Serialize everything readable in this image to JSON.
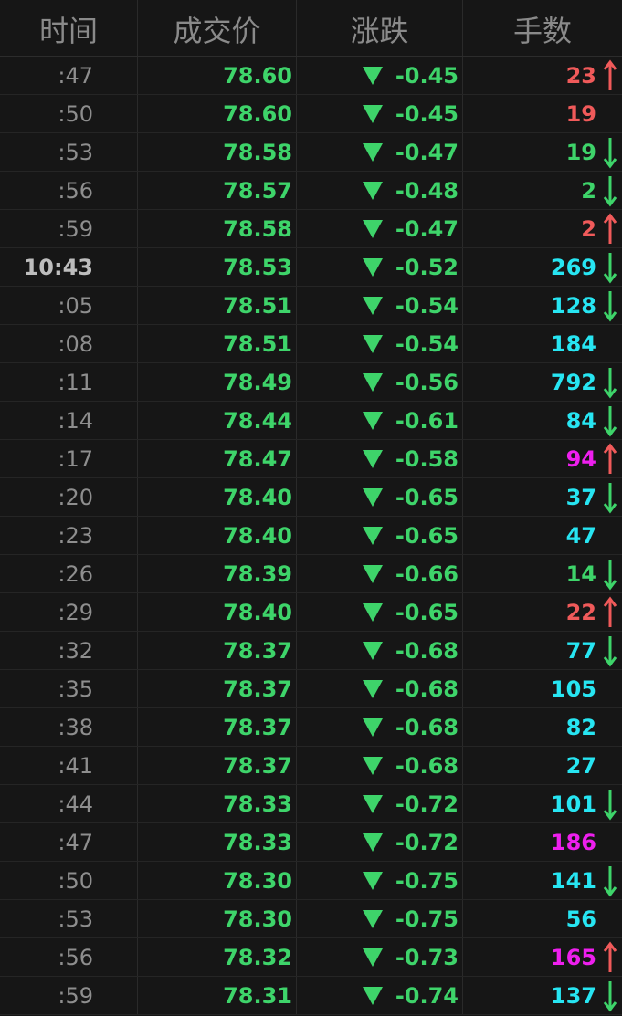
{
  "headers": {
    "time": "时间",
    "price": "成交价",
    "change": "涨跌",
    "volume": "手数"
  },
  "colors": {
    "green": "#3ed46a",
    "red": "#f05a5a",
    "cyan": "#27e5f2",
    "magenta": "#ee1fee",
    "gray_text": "#8e8e8e"
  },
  "rows": [
    {
      "time": ":47",
      "price": "78.60",
      "change": "-0.45",
      "volume": "23",
      "vol_color": "red",
      "arrow": "up"
    },
    {
      "time": ":50",
      "price": "78.60",
      "change": "-0.45",
      "volume": "19",
      "vol_color": "red",
      "arrow": "none"
    },
    {
      "time": ":53",
      "price": "78.58",
      "change": "-0.47",
      "volume": "19",
      "vol_color": "green",
      "arrow": "down"
    },
    {
      "time": ":56",
      "price": "78.57",
      "change": "-0.48",
      "volume": "2",
      "vol_color": "green",
      "arrow": "down"
    },
    {
      "time": ":59",
      "price": "78.58",
      "change": "-0.47",
      "volume": "2",
      "vol_color": "red",
      "arrow": "up"
    },
    {
      "time": "10:43",
      "price": "78.53",
      "change": "-0.52",
      "volume": "269",
      "vol_color": "cyan",
      "arrow": "down",
      "major": true
    },
    {
      "time": ":05",
      "price": "78.51",
      "change": "-0.54",
      "volume": "128",
      "vol_color": "cyan",
      "arrow": "down"
    },
    {
      "time": ":08",
      "price": "78.51",
      "change": "-0.54",
      "volume": "184",
      "vol_color": "cyan",
      "arrow": "none"
    },
    {
      "time": ":11",
      "price": "78.49",
      "change": "-0.56",
      "volume": "792",
      "vol_color": "cyan",
      "arrow": "down"
    },
    {
      "time": ":14",
      "price": "78.44",
      "change": "-0.61",
      "volume": "84",
      "vol_color": "cyan",
      "arrow": "down"
    },
    {
      "time": ":17",
      "price": "78.47",
      "change": "-0.58",
      "volume": "94",
      "vol_color": "magenta",
      "arrow": "up"
    },
    {
      "time": ":20",
      "price": "78.40",
      "change": "-0.65",
      "volume": "37",
      "vol_color": "cyan",
      "arrow": "down"
    },
    {
      "time": ":23",
      "price": "78.40",
      "change": "-0.65",
      "volume": "47",
      "vol_color": "cyan",
      "arrow": "none"
    },
    {
      "time": ":26",
      "price": "78.39",
      "change": "-0.66",
      "volume": "14",
      "vol_color": "green",
      "arrow": "down"
    },
    {
      "time": ":29",
      "price": "78.40",
      "change": "-0.65",
      "volume": "22",
      "vol_color": "red",
      "arrow": "up"
    },
    {
      "time": ":32",
      "price": "78.37",
      "change": "-0.68",
      "volume": "77",
      "vol_color": "cyan",
      "arrow": "down"
    },
    {
      "time": ":35",
      "price": "78.37",
      "change": "-0.68",
      "volume": "105",
      "vol_color": "cyan",
      "arrow": "none"
    },
    {
      "time": ":38",
      "price": "78.37",
      "change": "-0.68",
      "volume": "82",
      "vol_color": "cyan",
      "arrow": "none"
    },
    {
      "time": ":41",
      "price": "78.37",
      "change": "-0.68",
      "volume": "27",
      "vol_color": "cyan",
      "arrow": "none"
    },
    {
      "time": ":44",
      "price": "78.33",
      "change": "-0.72",
      "volume": "101",
      "vol_color": "cyan",
      "arrow": "down"
    },
    {
      "time": ":47",
      "price": "78.33",
      "change": "-0.72",
      "volume": "186",
      "vol_color": "magenta",
      "arrow": "none"
    },
    {
      "time": ":50",
      "price": "78.30",
      "change": "-0.75",
      "volume": "141",
      "vol_color": "cyan",
      "arrow": "down"
    },
    {
      "time": ":53",
      "price": "78.30",
      "change": "-0.75",
      "volume": "56",
      "vol_color": "cyan",
      "arrow": "none"
    },
    {
      "time": ":56",
      "price": "78.32",
      "change": "-0.73",
      "volume": "165",
      "vol_color": "magenta",
      "arrow": "up"
    },
    {
      "time": ":59",
      "price": "78.31",
      "change": "-0.74",
      "volume": "137",
      "vol_color": "cyan",
      "arrow": "down"
    }
  ]
}
